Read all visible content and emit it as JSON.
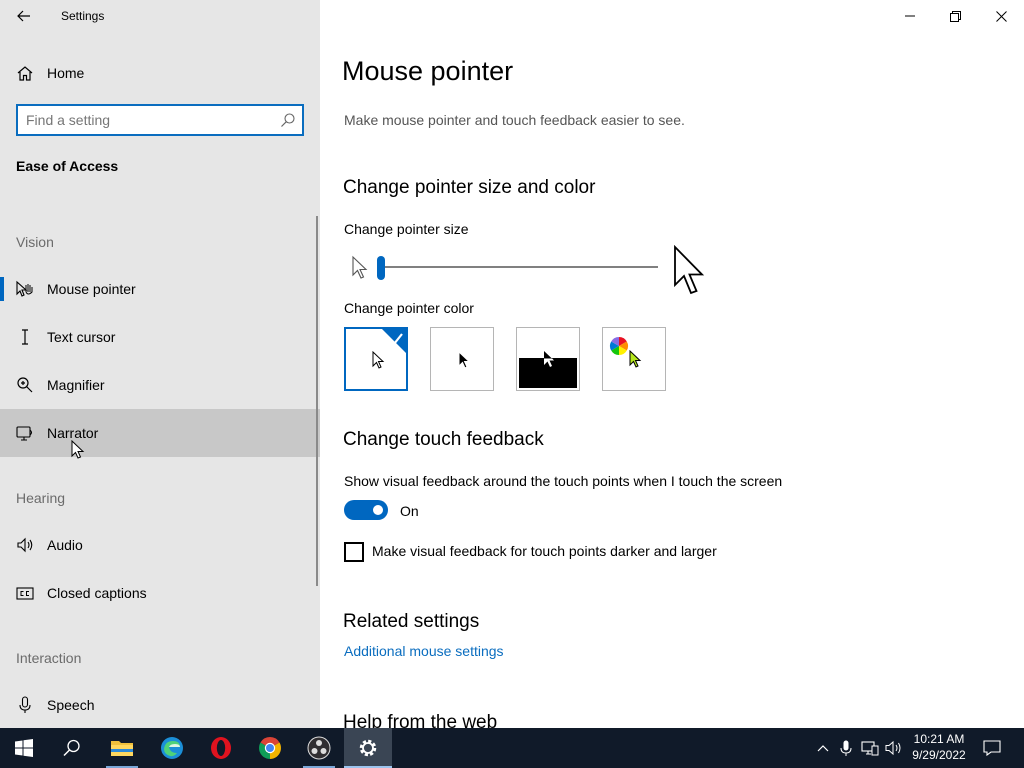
{
  "window": {
    "title": "Settings"
  },
  "sidebar": {
    "home_label": "Home",
    "search_placeholder": "Find a setting",
    "section_title": "Ease of Access",
    "groups": {
      "vision": "Vision",
      "hearing": "Hearing",
      "interaction": "Interaction"
    },
    "items": [
      {
        "label": "Mouse pointer",
        "icon": "mouse-pointer-icon",
        "selected": true
      },
      {
        "label": "Text cursor",
        "icon": "text-cursor-icon"
      },
      {
        "label": "Magnifier",
        "icon": "magnifier-icon"
      },
      {
        "label": "Narrator",
        "icon": "narrator-icon",
        "hovered": true
      },
      {
        "label": "Audio",
        "icon": "speaker-icon"
      },
      {
        "label": "Closed captions",
        "icon": "closed-captions-icon"
      },
      {
        "label": "Speech",
        "icon": "microphone-icon"
      }
    ]
  },
  "main": {
    "page_title": "Mouse pointer",
    "description": "Make mouse pointer and touch feedback easier to see.",
    "size_color_heading": "Change pointer size and color",
    "pointer_size_label": "Change pointer size",
    "pointer_size_value": 1,
    "pointer_color_label": "Change pointer color",
    "pointer_color_options": [
      {
        "name": "white",
        "selected": true
      },
      {
        "name": "black",
        "selected": false
      },
      {
        "name": "inverted",
        "selected": false
      },
      {
        "name": "custom",
        "selected": false
      }
    ],
    "touch_heading": "Change touch feedback",
    "touch_label": "Show visual feedback around the touch points when I touch the screen",
    "toggle_state": "On",
    "checkbox_label": "Make visual feedback for touch points darker and larger",
    "checkbox_checked": false,
    "related_heading": "Related settings",
    "related_link": "Additional mouse settings",
    "help_heading": "Help from the web"
  },
  "taskbar": {
    "apps": [
      "start-icon",
      "search-icon",
      "file-explorer-icon",
      "edge-icon",
      "opera-icon",
      "chrome-icon",
      "obs-icon",
      "settings-icon"
    ],
    "time": "10:21 AM",
    "date": "9/29/2022"
  },
  "colors": {
    "accent": "#0067c0",
    "sidebar_bg": "#e6e6e6",
    "taskbar_bg": "#101a29"
  }
}
